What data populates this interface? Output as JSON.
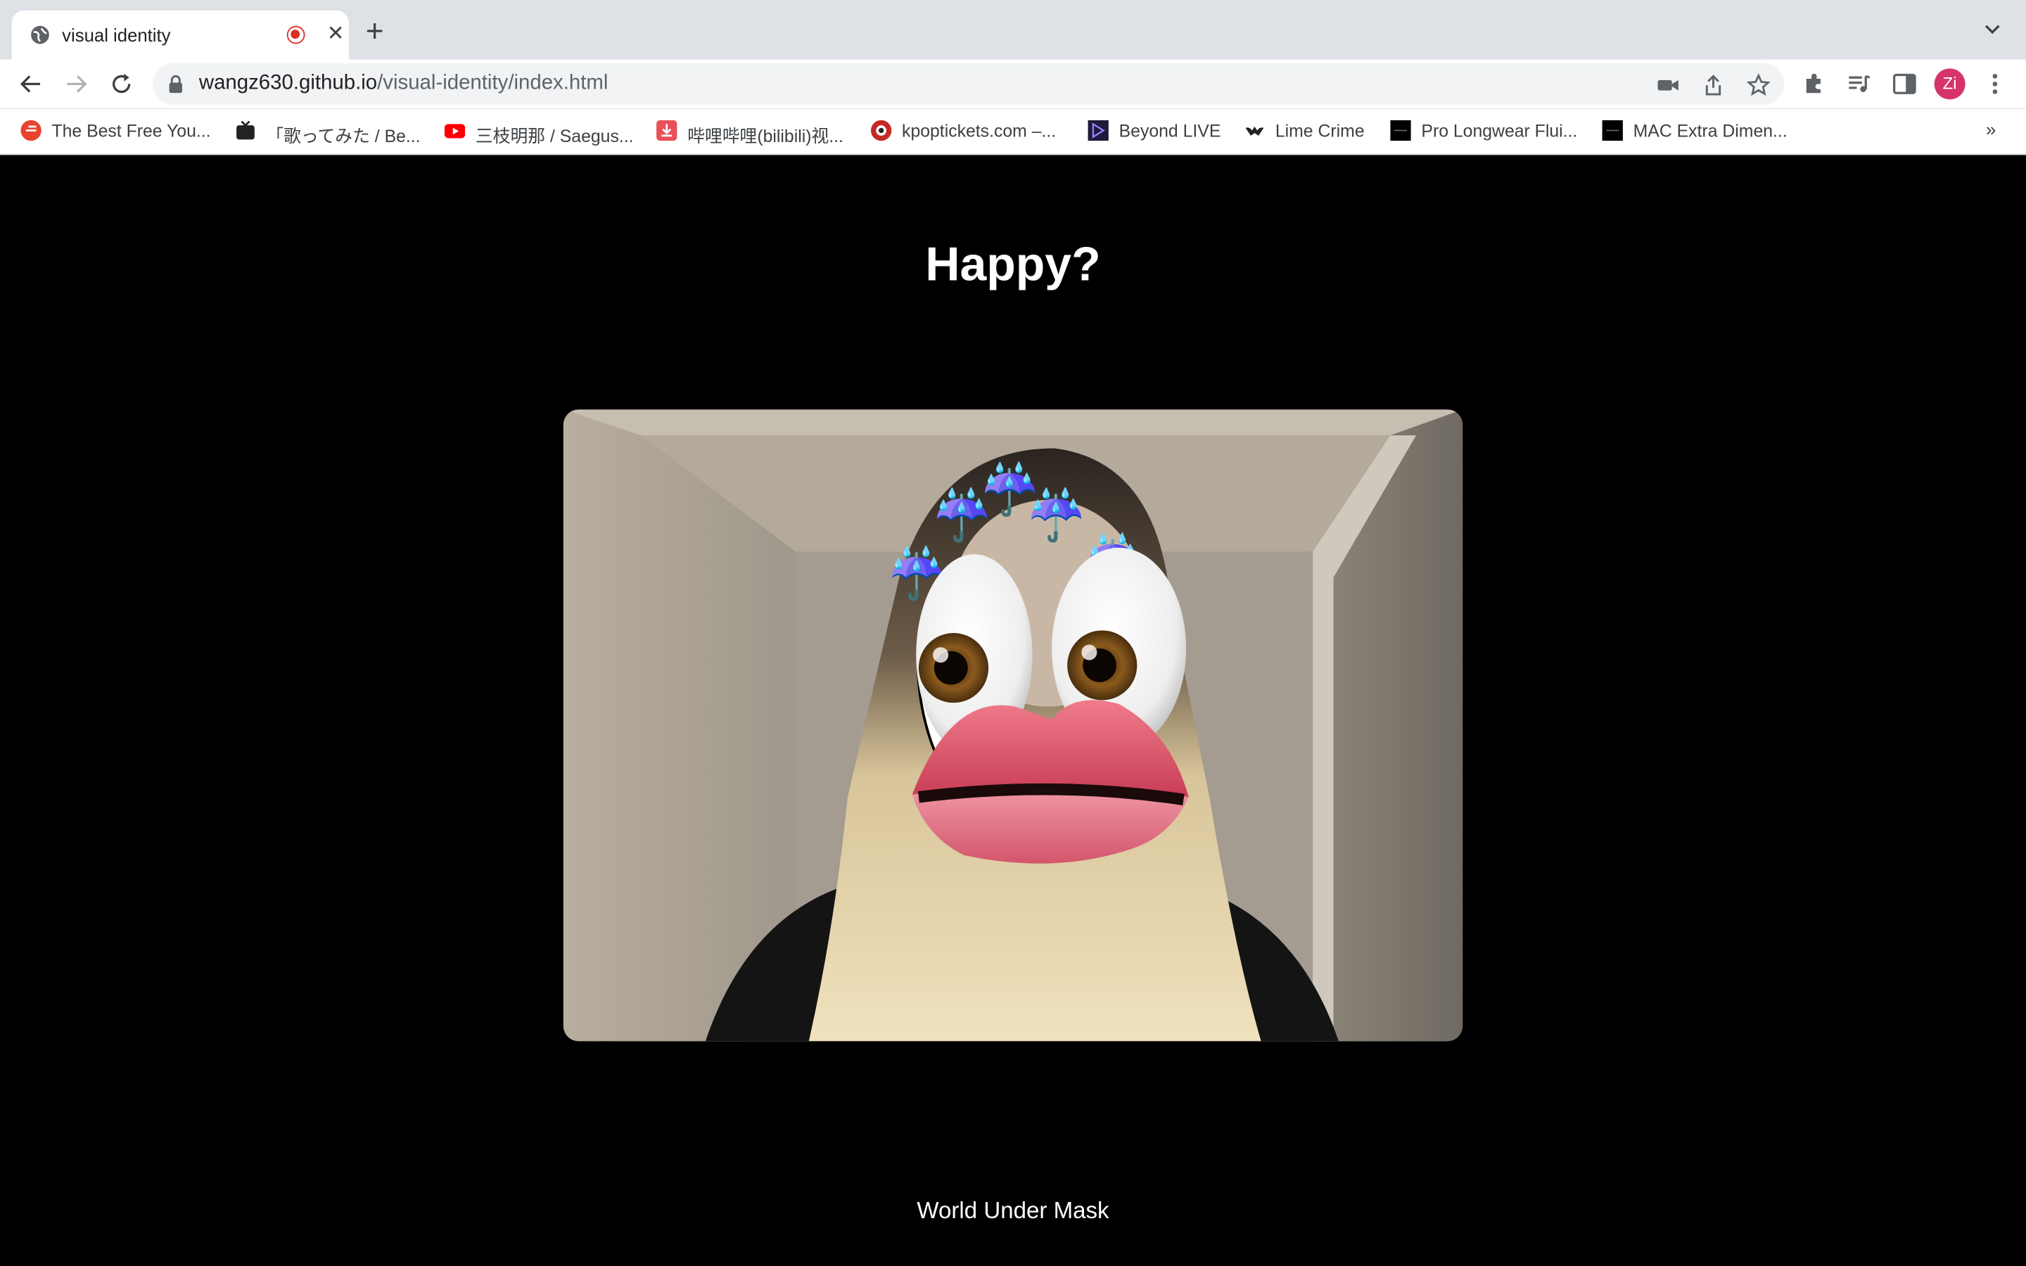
{
  "browser": {
    "tab": {
      "title": "visual identity",
      "favicon": "globe-icon",
      "recording_indicator": "record-icon"
    },
    "url": {
      "host": "wangz630.github.io",
      "path": "/visual-identity/index.html"
    },
    "profile_initial": "Zi",
    "bookmarks": [
      {
        "label": "The Best Free You...",
        "icon": "red-circle-icon"
      },
      {
        "label": "「歌ってみた / Be...",
        "icon": "tv-icon"
      },
      {
        "label": "三枝明那 / Saegus...",
        "icon": "youtube-icon"
      },
      {
        "label": "哔哩哔哩(bilibili)视...",
        "icon": "download-icon"
      },
      {
        "label": "kpoptickets.com –...",
        "icon": "ticket-icon"
      },
      {
        "label": "Beyond LIVE",
        "icon": "beyond-live-icon"
      },
      {
        "label": "Lime Crime",
        "icon": "bat-icon"
      },
      {
        "label": "Pro Longwear Flui...",
        "icon": "mac-icon"
      },
      {
        "label": "MAC Extra Dimen...",
        "icon": "mac-icon"
      }
    ],
    "more_bookmarks": "»"
  },
  "page": {
    "heading": "Happy?",
    "video_caption": "World Under Mask"
  },
  "colors": {
    "page_background": "#000000",
    "tabstrip": "#dee1e6",
    "profile": "#d6336c"
  }
}
